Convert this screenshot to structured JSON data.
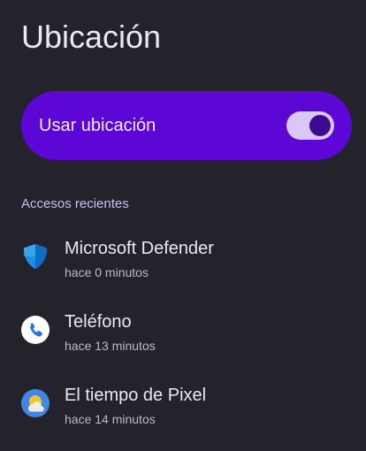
{
  "page": {
    "title": "Ubicación"
  },
  "location_toggle": {
    "label": "Usar ubicación",
    "state": "on"
  },
  "recent_access": {
    "header": "Accesos recientes",
    "apps": [
      {
        "name": "Microsoft Defender",
        "time": "hace 0 minutos",
        "icon": "shield-icon"
      },
      {
        "name": "Teléfono",
        "time": "hace 13 minutos",
        "icon": "phone-icon"
      },
      {
        "name": "El tiempo de Pixel",
        "time": "hace 14 minutos",
        "icon": "weather-icon"
      }
    ]
  },
  "colors": {
    "background": "#24222b",
    "accent": "#5d07d6",
    "switch_track": "#d9c7f7",
    "switch_thumb": "#3b0a8e",
    "section_header": "#cfbcf4"
  }
}
